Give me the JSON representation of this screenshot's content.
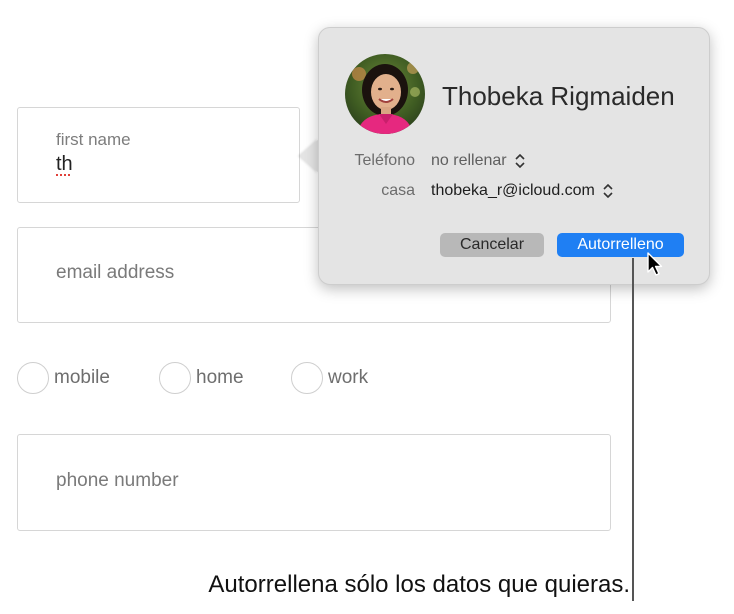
{
  "form": {
    "first_name": {
      "label": "first name",
      "value": "th"
    },
    "email": {
      "placeholder": "email address"
    },
    "phone_type": {
      "options": [
        "mobile",
        "home",
        "work"
      ]
    },
    "phone": {
      "placeholder": "phone number"
    }
  },
  "autofill_popover": {
    "contact_name": "Thobeka Rigmaiden",
    "rows": [
      {
        "label": "Teléfono",
        "value": "no rellenar"
      },
      {
        "label": "casa",
        "value": "thobeka_r@icloud.com"
      }
    ],
    "cancel_label": "Cancelar",
    "autofill_label": "Autorrelleno",
    "colors": {
      "accent": "#1f7ff3",
      "background": "#e4e4e4"
    }
  },
  "caption": "Autorrellena sólo los datos que quieras."
}
